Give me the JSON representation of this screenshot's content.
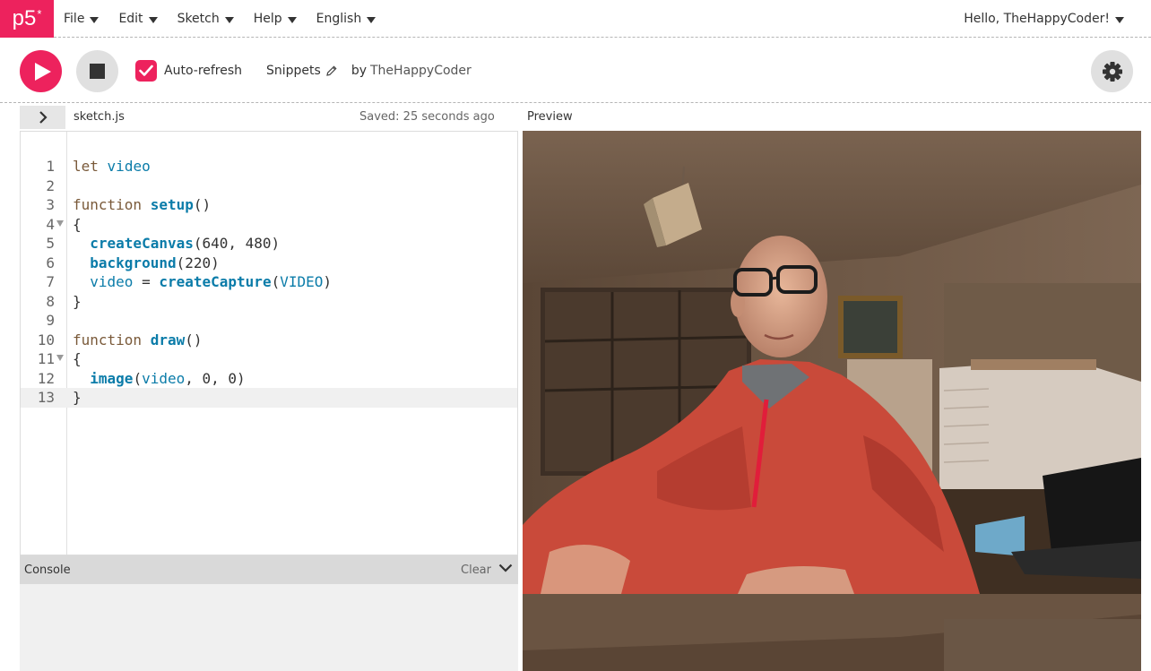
{
  "nav": {
    "logo_text": "p5",
    "logo_sup": "*",
    "menus": [
      {
        "label": "File"
      },
      {
        "label": "Edit"
      },
      {
        "label": "Sketch"
      },
      {
        "label": "Help"
      },
      {
        "label": "English"
      }
    ],
    "user_greeting": "Hello, TheHappyCoder!"
  },
  "toolbar": {
    "play_icon": "play-icon",
    "stop_icon": "stop-icon",
    "auto_refresh_label": "Auto-refresh",
    "auto_refresh_checked": true,
    "project_name": "Snippets",
    "owner_prefix": "by",
    "owner_name": "TheHappyCoder",
    "settings_icon": "gear-icon"
  },
  "editor": {
    "file_name": "sketch.js",
    "saved_status": "Saved: 25 seconds ago",
    "preview_label": "Preview",
    "line_numbers": [
      "1",
      "2",
      "3",
      "4",
      "5",
      "6",
      "7",
      "8",
      "9",
      "10",
      "11",
      "12",
      "13"
    ],
    "active_line": 13
  },
  "console": {
    "title": "Console",
    "clear_label": "Clear"
  },
  "colors": {
    "accent": "#ed225d",
    "code_keyword": "#7a5a3a",
    "code_function": "#0b7ca9"
  }
}
